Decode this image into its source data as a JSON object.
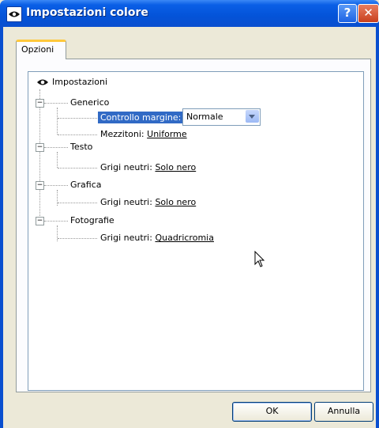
{
  "window": {
    "title": "Impostazioni colore",
    "help_glyph": "?",
    "close_glyph": "✕"
  },
  "tabs": [
    {
      "label": "Opzioni",
      "active": true
    }
  ],
  "tree": {
    "root": "Impostazioni",
    "generico": {
      "label": "Generico",
      "controllo_margine": {
        "label": "Controllo margine:",
        "value": "Normale"
      },
      "mezzitoni": {
        "label": "Mezzitoni:",
        "value": "Uniforme"
      }
    },
    "testo": {
      "label": "Testo",
      "grigi_label": "Grigi neutri:",
      "grigi_value": "Solo nero"
    },
    "grafica": {
      "label": "Grafica",
      "grigi_label": "Grigi neutri:",
      "grigi_value": "Solo nero"
    },
    "fotografie": {
      "label": "Fotografie",
      "grigi_label": "Grigi neutri:",
      "grigi_value": "Quadricromia"
    },
    "collapse_glyph": "−"
  },
  "buttons": {
    "ok": "OK",
    "cancel": "Annulla"
  },
  "colors": {
    "titlebar": "#0453d8",
    "selection": "#316ac5",
    "dialog_bg": "#ece9d8"
  }
}
